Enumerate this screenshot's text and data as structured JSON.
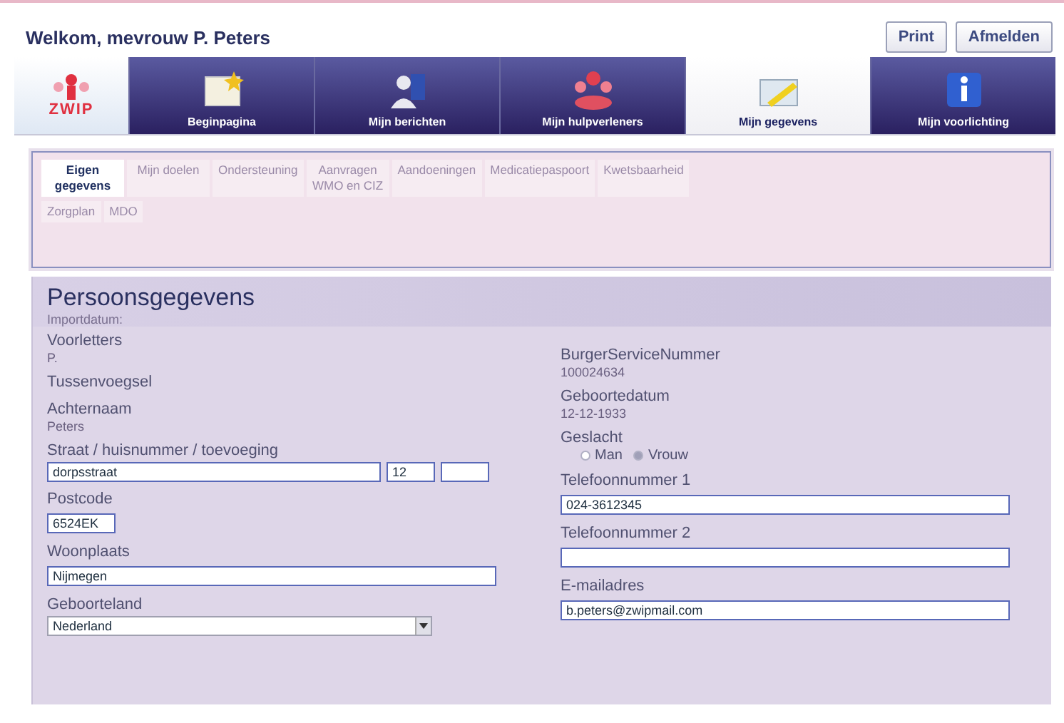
{
  "header": {
    "title": "Welkom, mevrouw P. Peters",
    "buttons": [
      "Print",
      "Afmelden"
    ]
  },
  "nav": {
    "logo": "ZWIP",
    "tabs": [
      {
        "label": "Beginpagina",
        "selected": false
      },
      {
        "label": "Mijn berichten",
        "selected": false
      },
      {
        "label": "Mijn hulpverleners",
        "selected": false
      },
      {
        "label": "Mijn gegevens",
        "selected": true
      },
      {
        "label": "Mijn voorlichting",
        "selected": false
      }
    ]
  },
  "subtabs": [
    [
      {
        "label": "Eigen gegevens",
        "selected": true
      },
      {
        "label": "Mijn doelen",
        "selected": false
      },
      {
        "label": "Ondersteuning",
        "selected": false
      },
      {
        "label": "Aanvragen WMO en CIZ",
        "selected": false
      },
      {
        "label": "Aandoeningen",
        "selected": false
      },
      {
        "label": "Medicatiepaspoort",
        "selected": false
      },
      {
        "label": "Kwetsbaarheid",
        "selected": false
      }
    ],
    [
      {
        "label": "Zorgplan",
        "selected": false
      },
      {
        "label": "MDO",
        "selected": false
      }
    ]
  ],
  "form": {
    "title": "Persoonsgegevens",
    "subtitle": "Importdatum:",
    "left": [
      {
        "kind": "display",
        "label": "Voorletters",
        "value": "P."
      },
      {
        "kind": "display",
        "label": "Tussenvoegsel"
      },
      {
        "kind": "display",
        "label": "Achternaam",
        "value": "Peters"
      },
      {
        "kind": "multi",
        "label": "Straat / huisnummer / toevoeging",
        "inputs": [
          {
            "kind": "input",
            "value": "dorpsstraat"
          },
          {
            "kind": "input",
            "value": "12"
          },
          {
            "kind": "input"
          }
        ]
      },
      {
        "kind": "short",
        "label": "Postcode",
        "value": "6524EK"
      },
      {
        "kind": "input",
        "label": "Woonplaats",
        "value": "Nijmegen"
      },
      {
        "kind": "select",
        "label": "Geboorteland",
        "value": "Nederland"
      }
    ],
    "right": [
      {
        "kind": "display",
        "label": "BurgerServiceNummer",
        "value": "100024634"
      },
      {
        "kind": "display",
        "label": "Geboortedatum",
        "value": "12-12-1933"
      },
      {
        "kind": "radio",
        "label": "Geslacht",
        "options": [
          {
            "label": "Man",
            "selected": false
          },
          {
            "label": "Vrouw",
            "selected": true
          }
        ]
      },
      {
        "kind": "input",
        "label": "Telefoonnummer 1",
        "value": "024-3612345"
      },
      {
        "kind": "input",
        "label": "Telefoonnummer 2"
      },
      {
        "kind": "input",
        "label": "E-mailadres",
        "value": "b.peters@zwipmail.com"
      }
    ]
  }
}
